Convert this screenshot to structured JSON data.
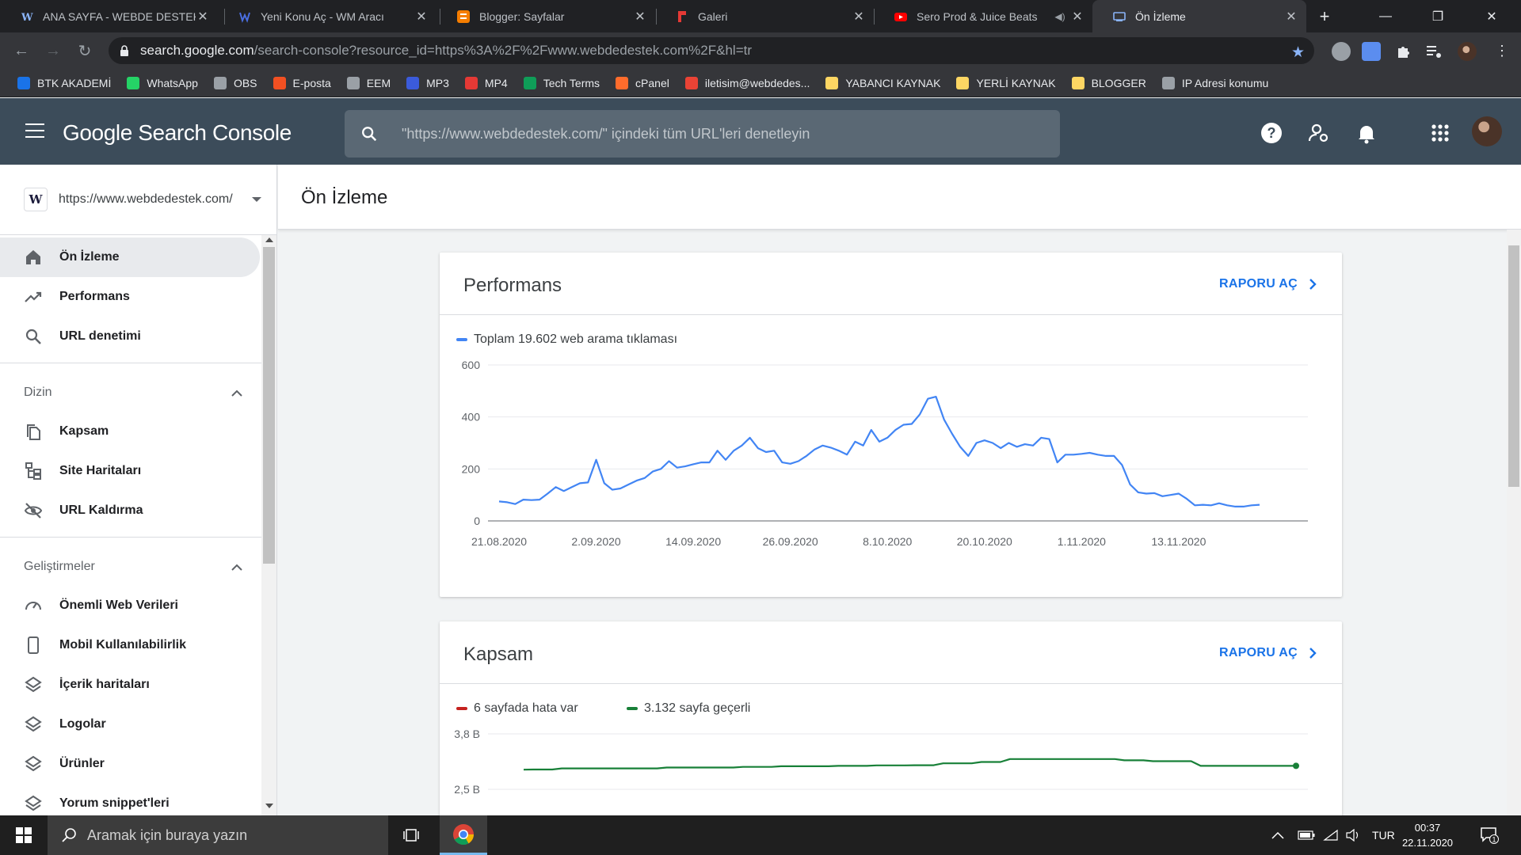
{
  "browser": {
    "tabs": [
      {
        "title": "ANA SAYFA - WEBDE DESTEK",
        "active": false
      },
      {
        "title": "Yeni Konu Aç - WM Aracı",
        "active": false
      },
      {
        "title": "Blogger: Sayfalar",
        "active": false
      },
      {
        "title": "Galeri",
        "active": false
      },
      {
        "title": "Sero Prod & Juice Beats",
        "active": false
      },
      {
        "title": "Ön İzleme",
        "active": true
      }
    ],
    "url_host": "search.google.com",
    "url_path": "/search-console?resource_id=https%3A%2F%2Fwww.webdedestek.com%2F&hl=tr",
    "bookmarks": [
      {
        "label": "BTK AKADEMİ",
        "color": "#1a73e8"
      },
      {
        "label": "WhatsApp",
        "color": "#25d366"
      },
      {
        "label": "OBS",
        "color": "#9aa0a6"
      },
      {
        "label": "E-posta",
        "color": "#f25022"
      },
      {
        "label": "EEM",
        "color": "#9aa0a6"
      },
      {
        "label": "MP3",
        "color": "#3b5bdb"
      },
      {
        "label": "MP4",
        "color": "#e53935"
      },
      {
        "label": "Tech Terms",
        "color": "#0f9d58"
      },
      {
        "label": "cPanel",
        "color": "#ff6c2c"
      },
      {
        "label": "iletisim@webdedes...",
        "color": "#ea4335"
      },
      {
        "label": "YABANCI KAYNAK",
        "color": "#fdd663"
      },
      {
        "label": "YERLİ KAYNAK",
        "color": "#fdd663"
      },
      {
        "label": "BLOGGER",
        "color": "#fdd663"
      },
      {
        "label": "IP Adresi konumu",
        "color": "#9aa0a6"
      }
    ]
  },
  "header": {
    "logo": "Google Search Console",
    "search_placeholder": "\"https://www.webdedestek.com/\" içindeki tüm URL'leri denetleyin"
  },
  "sidebar": {
    "property_url": "https://www.webdedestek.com/",
    "property_icon_letter": "W",
    "top_items": [
      {
        "label": "Ön İzleme",
        "icon": "home-icon",
        "active": true
      },
      {
        "label": "Performans",
        "icon": "trending-up-icon",
        "active": false
      },
      {
        "label": "URL denetimi",
        "icon": "search-icon",
        "active": false
      }
    ],
    "section_index": {
      "title": "Dizin",
      "items": [
        {
          "label": "Kapsam",
          "icon": "copy-pages-icon"
        },
        {
          "label": "Site Haritaları",
          "icon": "sitemap-icon"
        },
        {
          "label": "URL Kaldırma",
          "icon": "eye-off-icon"
        }
      ]
    },
    "section_enhancements": {
      "title": "Geliştirmeler",
      "items": [
        {
          "label": "Önemli Web Verileri",
          "icon": "gauge-icon"
        },
        {
          "label": "Mobil Kullanılabilirlik",
          "icon": "phone-icon"
        },
        {
          "label": "İçerik haritaları",
          "icon": "layers-icon"
        },
        {
          "label": "Logolar",
          "icon": "layers-icon"
        },
        {
          "label": "Ürünler",
          "icon": "layers-icon"
        },
        {
          "label": "Yorum snippet'leri",
          "icon": "layers-icon"
        }
      ]
    }
  },
  "main": {
    "page_title": "Ön İzleme",
    "performance_card": {
      "title": "Performans",
      "link": "RAPORU AÇ",
      "legend": "Toplam 19.602 web arama tıklaması"
    },
    "coverage_card": {
      "title": "Kapsam",
      "link": "RAPORU AÇ",
      "legend_error": "6 sayfada hata var",
      "legend_valid": "3.132 sayfa geçerli"
    }
  },
  "taskbar": {
    "search_placeholder": "Aramak için buraya yazın",
    "language": "TUR",
    "time": "00:37",
    "date": "22.11.2020",
    "notification_count": "1"
  },
  "chart_data": [
    {
      "type": "line",
      "title": "Performans",
      "series": [
        {
          "name": "Toplam 19.602 web arama tıklaması",
          "color": "#4285f4"
        }
      ],
      "x_start": "21.08.2020",
      "x_end": "20.11.2020",
      "xticks": [
        "21.08.2020",
        "2.09.2020",
        "14.09.2020",
        "26.09.2020",
        "8.10.2020",
        "20.10.2020",
        "1.11.2020",
        "13.11.2020"
      ],
      "yticks": [
        "0",
        "200",
        "400",
        "600"
      ],
      "ylim": [
        0,
        600
      ],
      "grid": true,
      "values": [
        75,
        72,
        65,
        82,
        80,
        82,
        105,
        130,
        115,
        130,
        145,
        148,
        235,
        145,
        120,
        125,
        140,
        155,
        165,
        190,
        200,
        230,
        205,
        210,
        218,
        225,
        225,
        270,
        235,
        270,
        290,
        320,
        280,
        265,
        270,
        225,
        220,
        230,
        250,
        275,
        290,
        282,
        270,
        255,
        305,
        290,
        350,
        305,
        320,
        350,
        370,
        373,
        410,
        470,
        478,
        390,
        335,
        285,
        250,
        300,
        310,
        300,
        280,
        300,
        285,
        295,
        290,
        320,
        315,
        225,
        255,
        255,
        258,
        262,
        255,
        250,
        250,
        215,
        140,
        110,
        105,
        107,
        95,
        100,
        105,
        85,
        60,
        62,
        60,
        68,
        60,
        55,
        55,
        60,
        62
      ]
    },
    {
      "type": "line",
      "title": "Kapsam",
      "series": [
        {
          "name": "3.132 sayfa geçerli",
          "color": "#188038"
        },
        {
          "name": "6 sayfada hata var",
          "color": "#c5221f"
        }
      ],
      "yticks": [
        "2,5 B",
        "3,8 B"
      ],
      "ylim": [
        2500,
        3800
      ],
      "grid": true,
      "values": [
        2960,
        2965,
        2965,
        2965,
        2990,
        2990,
        2990,
        2990,
        2990,
        2990,
        2990,
        2990,
        2990,
        2990,
        2990,
        3010,
        3010,
        3010,
        3010,
        3010,
        3010,
        3010,
        3010,
        3025,
        3025,
        3025,
        3025,
        3040,
        3040,
        3040,
        3040,
        3040,
        3040,
        3050,
        3050,
        3050,
        3050,
        3060,
        3060,
        3060,
        3060,
        3065,
        3065,
        3065,
        3110,
        3110,
        3110,
        3110,
        3140,
        3140,
        3140,
        3210,
        3210,
        3210,
        3210,
        3210,
        3210,
        3210,
        3210,
        3210,
        3210,
        3210,
        3210,
        3180,
        3180,
        3180,
        3160,
        3160,
        3160,
        3160,
        3160,
        3050,
        3050,
        3050,
        3050,
        3050,
        3050,
        3050,
        3050,
        3050,
        3050,
        3050
      ]
    }
  ]
}
